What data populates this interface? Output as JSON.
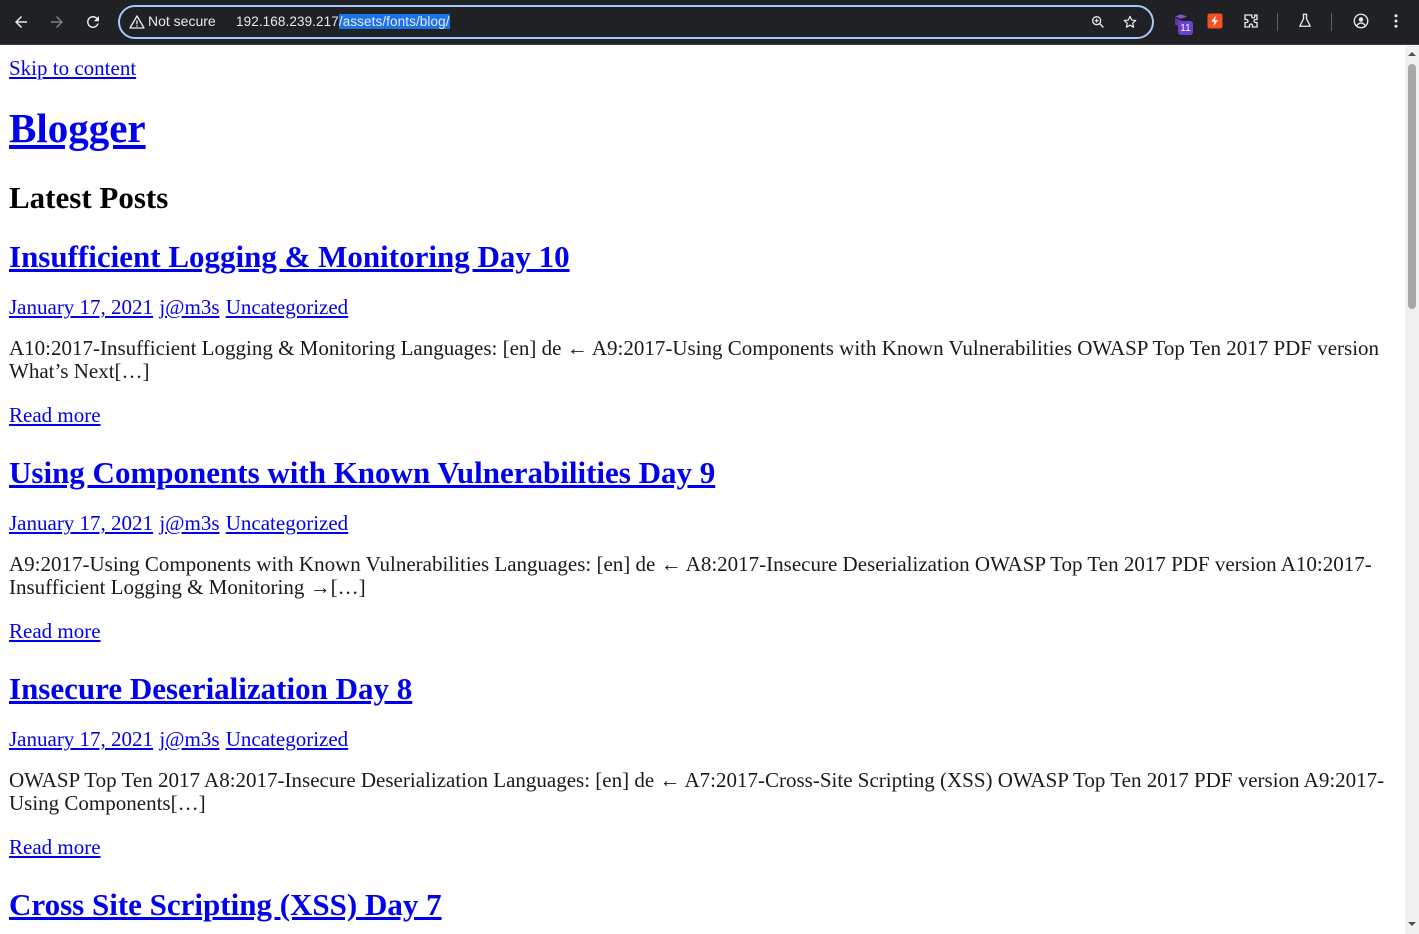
{
  "browser": {
    "security_label": "Not secure",
    "url_host": "192.168.239.217",
    "url_path": "/assets/fonts/blog/",
    "extension_badge": "11"
  },
  "page": {
    "skip_link": "Skip to content",
    "site_title": "Blogger",
    "section_title": "Latest Posts",
    "posts": [
      {
        "title": "Insufficient Logging & Monitoring Day 10",
        "date": "January 17, 2021",
        "author": "j@m3s",
        "category": "Uncategorized",
        "excerpt": "A10:2017-Insufficient Logging & Monitoring Languages: [en] de ← A9:2017-Using Components with Known Vulnerabilities OWASP Top Ten 2017 PDF version What’s Next[…]",
        "read_more": "Read more"
      },
      {
        "title": "Using Components with Known Vulnerabilities Day 9",
        "date": "January 17, 2021",
        "author": "j@m3s",
        "category": "Uncategorized",
        "excerpt": "A9:2017-Using Components with Known Vulnerabilities Languages: [en] de ← A8:2017-Insecure Deserialization OWASP Top Ten 2017 PDF version A10:2017-Insufficient Logging & Monitoring →[…]",
        "read_more": "Read more"
      },
      {
        "title": "Insecure Deserialization Day 8",
        "date": "January 17, 2021",
        "author": "j@m3s",
        "category": "Uncategorized",
        "excerpt": "OWASP Top Ten 2017 A8:2017-Insecure Deserialization Languages: [en] de ← A7:2017-Cross-Site Scripting (XSS) OWASP Top Ten 2017 PDF version A9:2017-Using Components[…]",
        "read_more": "Read more"
      },
      {
        "title": "Cross Site Scripting (XSS) Day 7"
      }
    ]
  },
  "colors": {
    "link": "#0000ee",
    "chrome_bg": "#202124",
    "omnibox_border": "#a8c7fa",
    "url_highlight": "#1a73e8"
  }
}
